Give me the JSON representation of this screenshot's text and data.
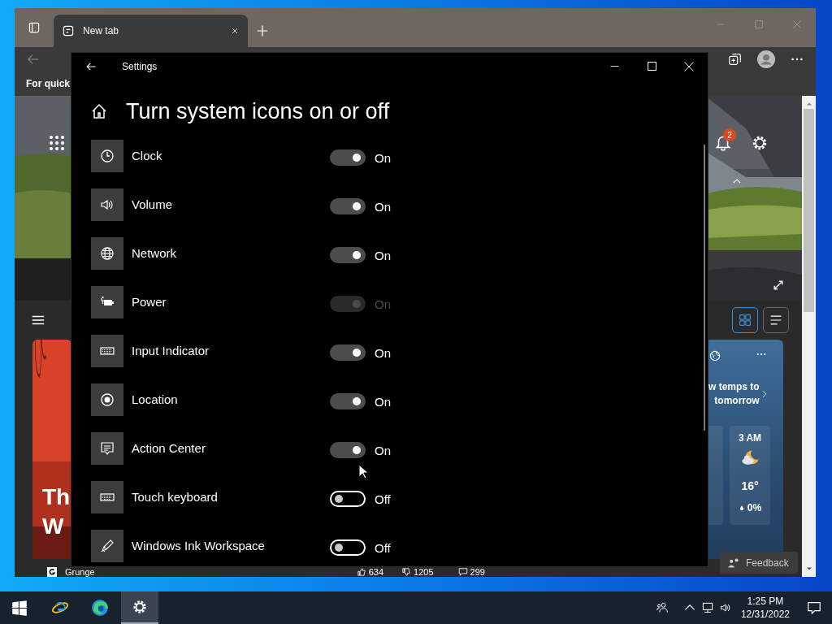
{
  "browser": {
    "tabs": [
      {
        "label": "New tab",
        "selected": true
      }
    ],
    "favorites_bar": {
      "text": "For quick"
    },
    "page": {
      "notification_count": "2",
      "story": {
        "title_lines": [
          "Th",
          "W"
        ],
        "source": "Grunge",
        "reactions": [
          "634",
          "1205",
          "299"
        ]
      },
      "weather": {
        "headline_lines": [
          "w temps to",
          "tomorrow"
        ],
        "hour": {
          "time": "3 AM",
          "temp": "16°",
          "precip": "0%"
        }
      },
      "feedback": "Feedback"
    }
  },
  "settings": {
    "window_title": "Settings",
    "heading": "Turn system icons on or off",
    "items": [
      {
        "label": "Clock",
        "on": true,
        "disabled": false,
        "state": "On"
      },
      {
        "label": "Volume",
        "on": true,
        "disabled": false,
        "state": "On"
      },
      {
        "label": "Network",
        "on": true,
        "disabled": false,
        "state": "On"
      },
      {
        "label": "Power",
        "on": true,
        "disabled": true,
        "state": "On"
      },
      {
        "label": "Input Indicator",
        "on": true,
        "disabled": false,
        "state": "On"
      },
      {
        "label": "Location",
        "on": true,
        "disabled": false,
        "state": "On"
      },
      {
        "label": "Action Center",
        "on": true,
        "disabled": false,
        "state": "On"
      },
      {
        "label": "Touch keyboard",
        "on": false,
        "disabled": false,
        "state": "Off"
      },
      {
        "label": "Windows Ink Workspace",
        "on": false,
        "disabled": false,
        "state": "Off"
      }
    ]
  },
  "taskbar": {
    "apps": [
      {
        "selected": false
      },
      {
        "selected": false
      },
      {
        "selected": true
      }
    ],
    "time": "1:25 PM",
    "date": "12/31/2022"
  }
}
